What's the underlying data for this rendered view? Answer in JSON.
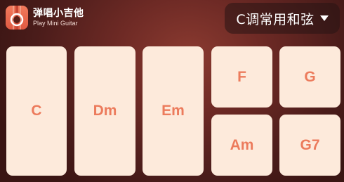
{
  "app": {
    "title": "弹唱小吉他",
    "subtitle": "Play Mini Guitar",
    "icon": "guitar-icon"
  },
  "key_selector": {
    "label": "C调常用和弦",
    "caret_icon": "caret-down-icon"
  },
  "chords": [
    {
      "label": "C"
    },
    {
      "label": "Dm"
    },
    {
      "label": "Em"
    },
    {
      "label": "F"
    },
    {
      "label": "G"
    },
    {
      "label": "Am"
    },
    {
      "label": "G7"
    }
  ],
  "colors": {
    "background": "#6e2a25",
    "chord_pad": "#fdeadb",
    "chord_text": "#ec7b5c",
    "app_icon": "#e05a42",
    "selector_bg": "#2a1414"
  }
}
